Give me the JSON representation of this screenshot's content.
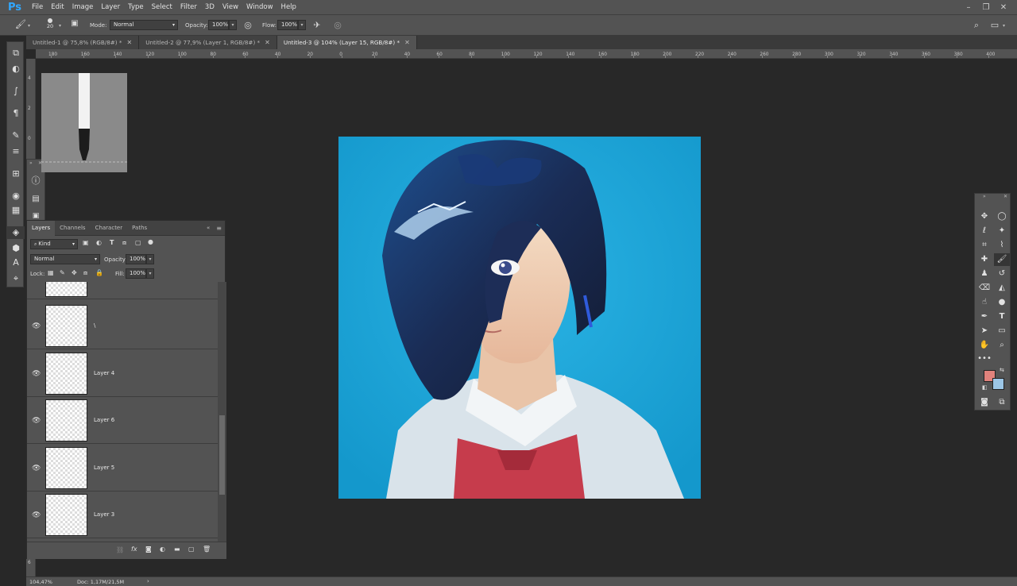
{
  "app": {
    "logo": "Ps"
  },
  "menu": [
    "File",
    "Edit",
    "Image",
    "Layer",
    "Type",
    "Select",
    "Filter",
    "3D",
    "View",
    "Window",
    "Help"
  ],
  "window_controls": [
    "minimize-icon",
    "restore-icon",
    "close-icon"
  ],
  "options": {
    "brush_size": "20",
    "mode_label": "Mode:",
    "mode_value": "Normal",
    "opacity_label": "Opacity:",
    "opacity_value": "100%",
    "flow_label": "Flow:",
    "flow_value": "100%"
  },
  "tabs": [
    {
      "label": "Untitled-1 @ 75,8% (RGB/8#) *",
      "active": false
    },
    {
      "label": "Untitled-2 @ 77,9% (Layer 1, RGB/8#) *",
      "active": false
    },
    {
      "label": "Untitled-3 @ 104% (Layer 15, RGB/8#) *",
      "active": true
    }
  ],
  "ruler_top": [
    "180",
    "160",
    "140",
    "120",
    "100",
    "80",
    "60",
    "40",
    "20",
    "0",
    "20",
    "40",
    "60",
    "80",
    "100",
    "120",
    "140",
    "160",
    "180",
    "200",
    "220",
    "240",
    "260",
    "280",
    "300",
    "320",
    "340",
    "360",
    "380",
    "400"
  ],
  "ruler_left": [
    "4",
    "2",
    "0",
    "6"
  ],
  "layers_panel": {
    "tabs": [
      "Layers",
      "Channels",
      "Character",
      "Paths"
    ],
    "filter_label": "Kind",
    "blend_mode": "Normal",
    "opacity_label": "Opacity:",
    "opacity_value": "100%",
    "lock_label": "Lock:",
    "fill_label": "Fill:",
    "fill_value": "100%",
    "layers": [
      {
        "name": "\\"
      },
      {
        "name": "Layer 4"
      },
      {
        "name": "Layer 6"
      },
      {
        "name": "Layer 5"
      },
      {
        "name": "Layer 3"
      }
    ]
  },
  "status": {
    "zoom": "104,47%",
    "doc": "Doc: 1,17M/21,5M"
  },
  "colors": {
    "foreground": "#e0827c",
    "background": "#9cc6e6",
    "canvas_bg": "#1ea6d8"
  }
}
